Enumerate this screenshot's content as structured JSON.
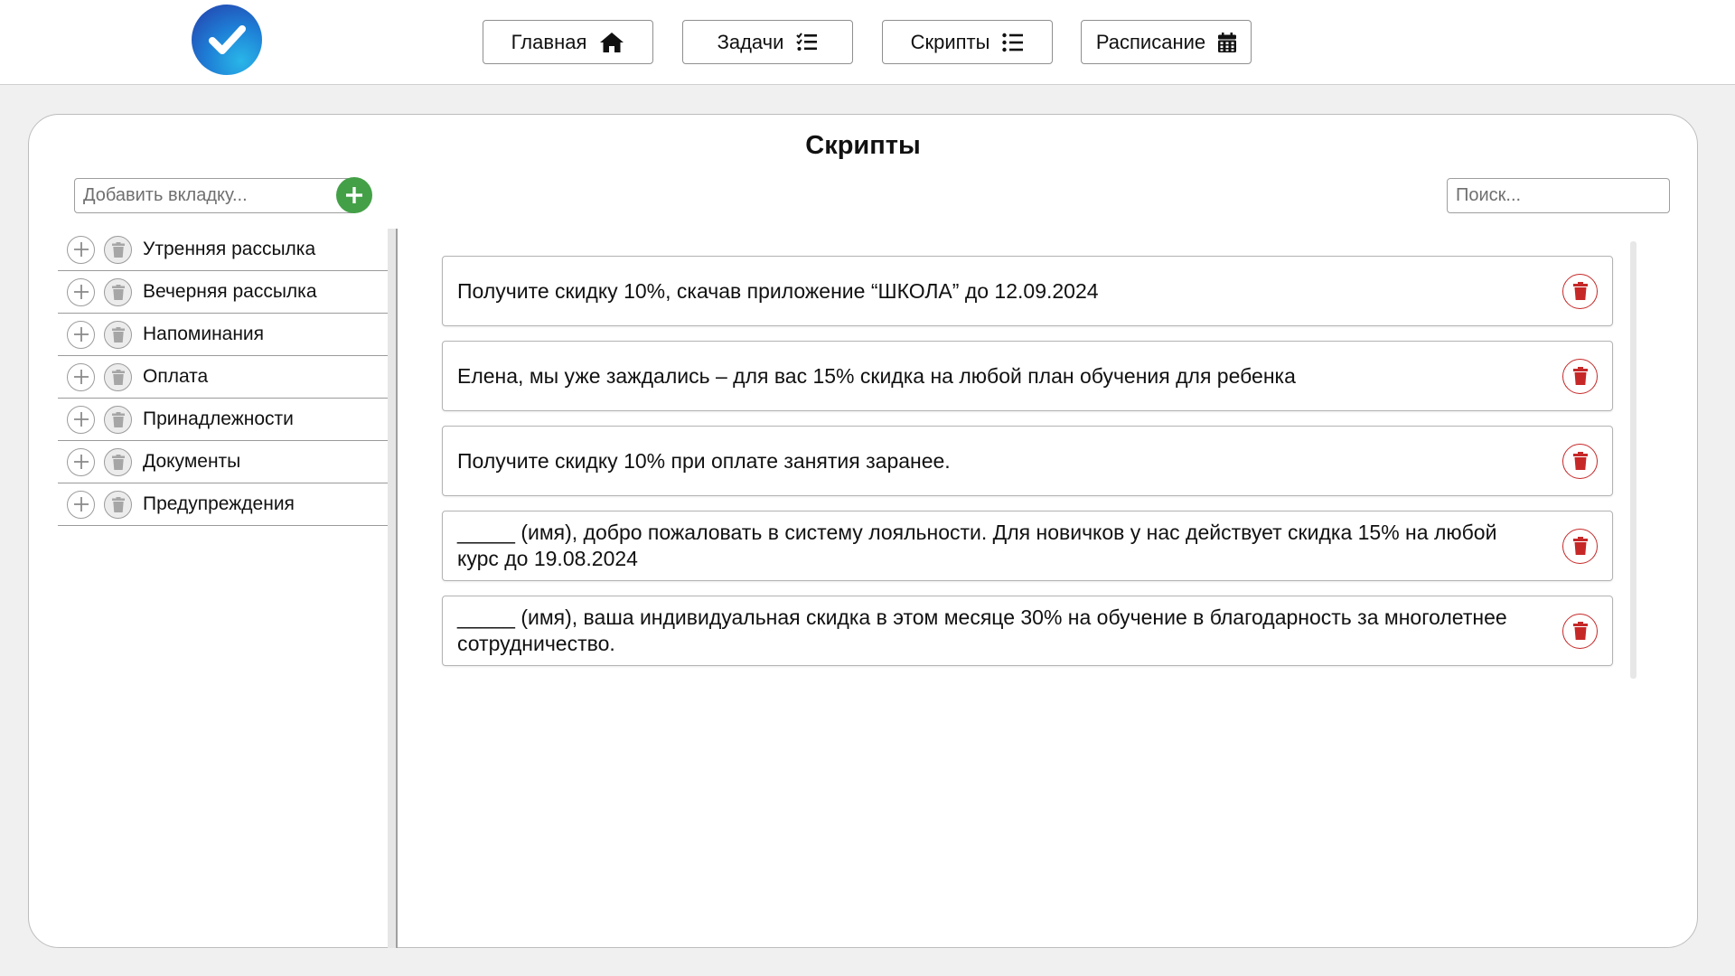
{
  "nav": {
    "home_label": "Главная",
    "tasks_label": "Задачи",
    "scripts_label": "Скрипты",
    "schedule_label": "Расписание"
  },
  "icons": {
    "logo": "check-icon",
    "home": "home-icon",
    "tasks": "task-list-icon",
    "scripts": "list-icon",
    "schedule": "calendar-icon",
    "add": "plus-icon",
    "delete": "trash-icon"
  },
  "colors": {
    "accent_green": "#43a047",
    "delete_red": "#c62828",
    "logo_blue": "#1e7fd6"
  },
  "page": {
    "title": "Скрипты"
  },
  "tabs_panel": {
    "add_tab_placeholder": "Добавить вкладку...",
    "search_placeholder": "Поиск...",
    "items": [
      {
        "label": "Утренняя рассылка"
      },
      {
        "label": "Вечерняя рассылка"
      },
      {
        "label": "Напоминания"
      },
      {
        "label": "Оплата"
      },
      {
        "label": "Принадлежности"
      },
      {
        "label": "Документы"
      },
      {
        "label": "Предупреждения"
      }
    ]
  },
  "scripts": [
    {
      "text": "Получите скидку 10%, скачав приложение “ШКОЛА” до 12.09.2024"
    },
    {
      "text": "Елена, мы уже заждались – для вас 15% скидка на любой план обучения для ребенка"
    },
    {
      "text": "Получите скидку 10% при оплате занятия заранее."
    },
    {
      "text": "_____ (имя), добро пожаловать в систему лояльности. Для новичков у нас действует скидка 15% на любой курс до 19.08.2024"
    },
    {
      "text": "_____ (имя), ваша индивидуальная скидка в этом месяце 30% на обучение в благодарность за многолетнее сотрудничество."
    }
  ]
}
